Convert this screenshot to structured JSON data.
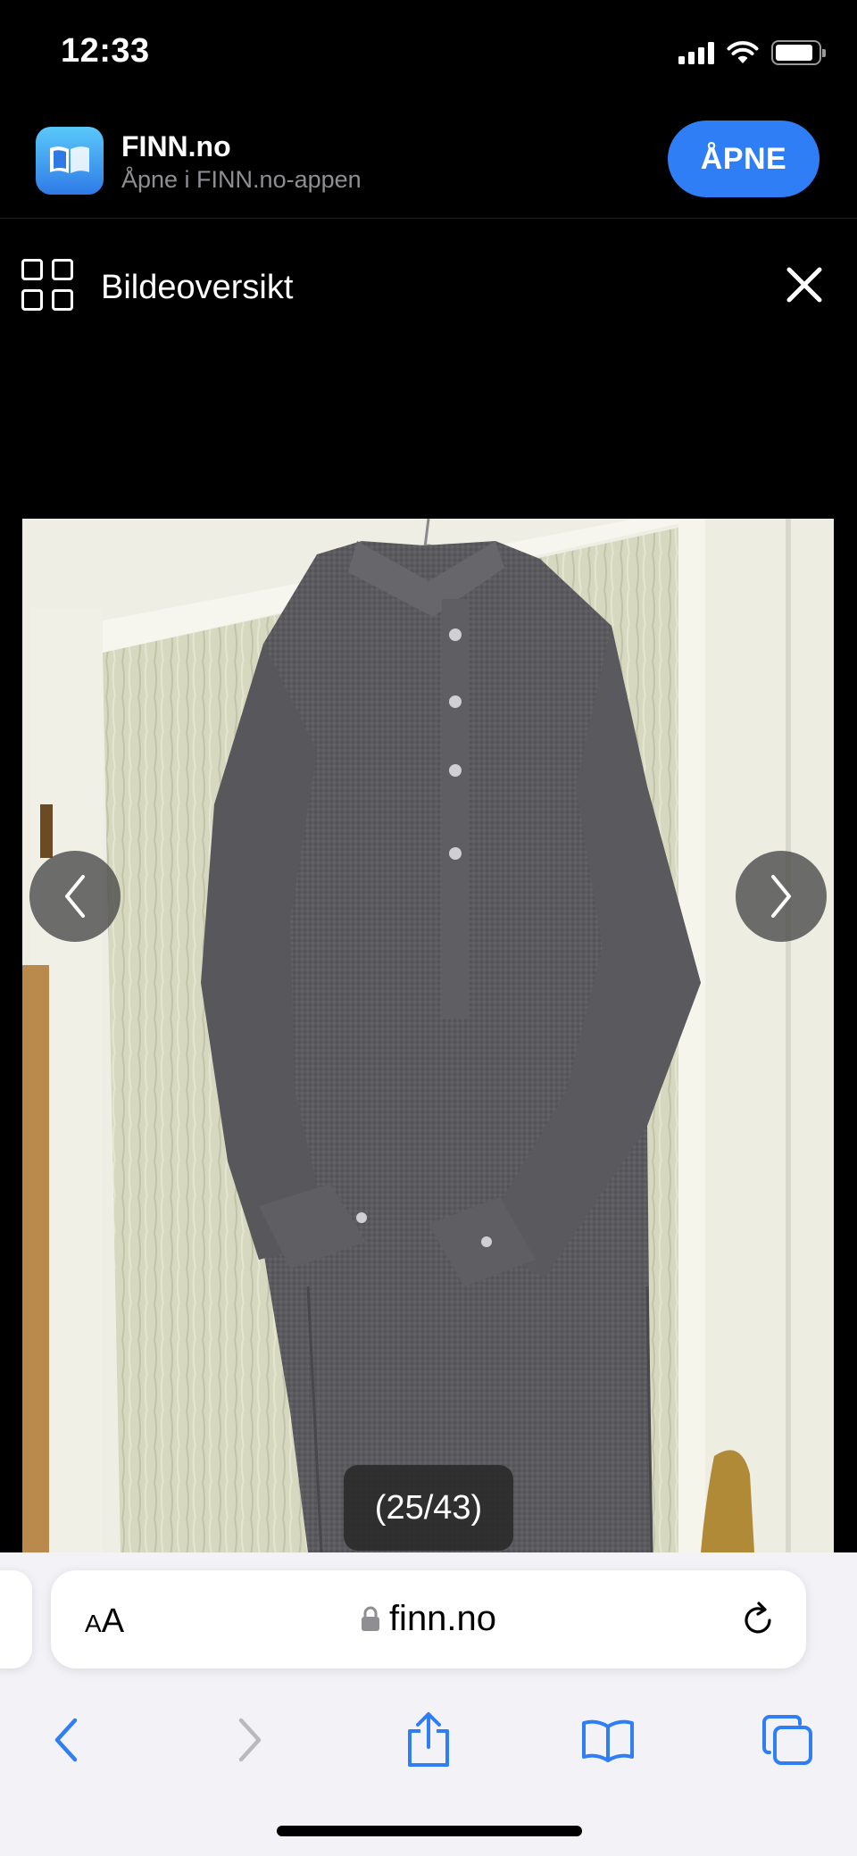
{
  "status_bar": {
    "time": "12:33"
  },
  "app_banner": {
    "app_name": "FINN.no",
    "subtitle": "Åpne i FINN.no-appen",
    "open_label": "ÅPNE"
  },
  "viewer": {
    "title": "Bildeoversikt",
    "counter": "(25/43)",
    "current_image": 25,
    "total_images": 43
  },
  "safari": {
    "text_size_label_small": "A",
    "text_size_label_large": "A",
    "url": "finn.no"
  },
  "icons": {
    "grid": "grid-icon",
    "close": "close-icon",
    "prev": "chevron-left-icon",
    "next": "chevron-right-icon",
    "lock": "lock-icon",
    "reload": "reload-icon",
    "back": "back-icon",
    "forward": "forward-icon",
    "share": "share-icon",
    "bookmarks": "book-icon",
    "tabs": "tabs-icon"
  },
  "colors": {
    "accent": "#2f7ef5",
    "safari_blue": "#2f7ef5",
    "background": "#000000",
    "toolbar_bg": "#f2f2f7"
  }
}
